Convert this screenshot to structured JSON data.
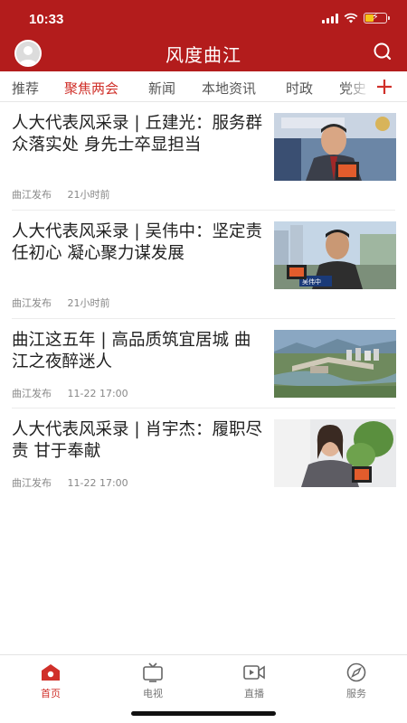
{
  "status_bar": {
    "time": "10:33"
  },
  "header": {
    "title": "风度曲江"
  },
  "tabs": [
    {
      "label": "推荐"
    },
    {
      "label": "聚焦两会",
      "active": true
    },
    {
      "label": "新闻"
    },
    {
      "label": "本地资讯"
    },
    {
      "label": "时政"
    },
    {
      "label": "党史"
    }
  ],
  "news": [
    {
      "title": "人大代表风采录 | 丘建光：服务群众落实处 身先士卒显担当",
      "source": "曲江发布",
      "time": "21小时前",
      "badge": ""
    },
    {
      "title": "人大代表风采录 | 吴伟中：坚定责任初心 凝心聚力谋发展",
      "source": "曲江发布",
      "time": "21小时前",
      "badge": "吴伟中"
    },
    {
      "title": "曲江这五年 | 高品质筑宜居城 曲江之夜醉迷人",
      "source": "曲江发布",
      "time": "11-22 17:00",
      "badge": ""
    },
    {
      "title": "人大代表风采录 | 肖宇杰：履职尽责 甘于奉献",
      "source": "曲江发布",
      "time": "11-22 17:00",
      "badge": ""
    }
  ],
  "bottom_nav": [
    {
      "label": "首页",
      "icon": "home-icon",
      "active": true
    },
    {
      "label": "电视",
      "icon": "tv-icon"
    },
    {
      "label": "直播",
      "icon": "live-video-icon"
    },
    {
      "label": "服务",
      "icon": "compass-icon"
    }
  ],
  "colors": {
    "brand": "#b31c1c",
    "accent": "#d0302a"
  }
}
